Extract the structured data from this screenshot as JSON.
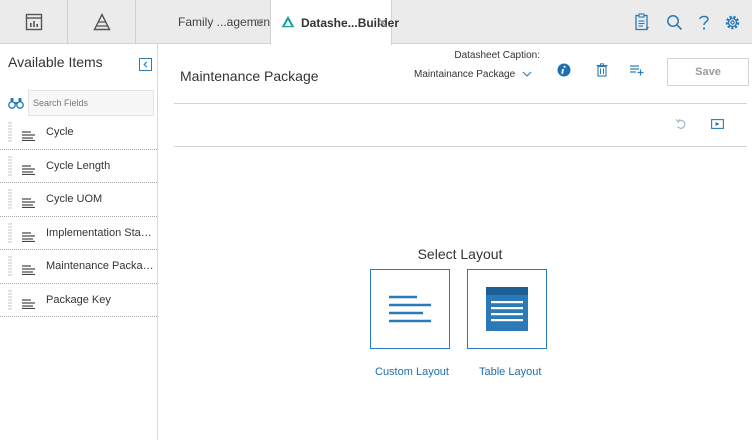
{
  "topbar": {
    "tabs": [
      {
        "label": "Family ...agement",
        "active": false
      },
      {
        "label": "Datashe...Builder",
        "active": true
      }
    ]
  },
  "left_panel": {
    "title": "Available Items",
    "search_placeholder": "Search Fields",
    "items": [
      {
        "label": "Cycle"
      },
      {
        "label": "Cycle Length"
      },
      {
        "label": "Cycle UOM"
      },
      {
        "label": "Implementation Status"
      },
      {
        "label": "Maintenance Package..."
      },
      {
        "label": "Package Key"
      }
    ]
  },
  "header": {
    "page_title": "Maintenance Package",
    "caption_label": "Datasheet Caption:",
    "caption_value": "Maintainance Package",
    "save_label": "Save"
  },
  "layout_picker": {
    "title": "Select Layout",
    "options": [
      {
        "label": "Custom Layout",
        "icon": "custom-layout-icon"
      },
      {
        "label": "Table Layout",
        "icon": "table-layout-icon"
      }
    ]
  },
  "colors": {
    "accent": "#2a7ab8",
    "link": "#1e6fb0",
    "topbar_bg": "#ebebeb",
    "active_tab_icon": "#1aa3a3"
  }
}
